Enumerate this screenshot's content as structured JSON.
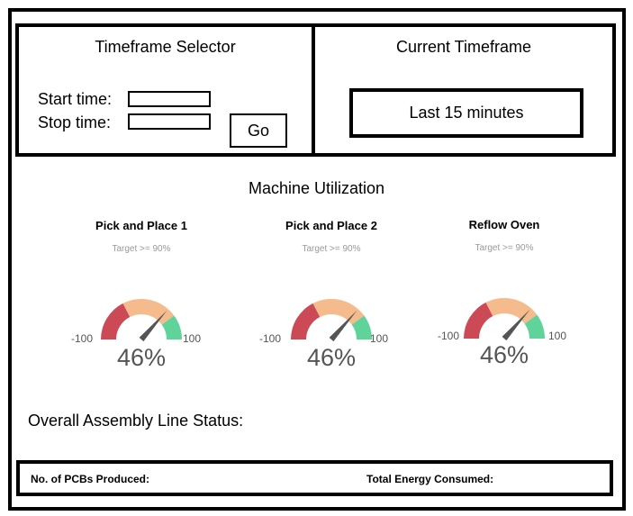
{
  "timeframe_selector": {
    "title": "Timeframe Selector",
    "start_label": "Start time:",
    "start_value": "",
    "stop_label": "Stop time:",
    "stop_value": "",
    "go_label": "Go"
  },
  "current_timeframe": {
    "title": "Current Timeframe",
    "value": "Last 15 minutes"
  },
  "machine_utilization": {
    "title": "Machine Utilization",
    "gauges": [
      {
        "name": "Pick and Place 1",
        "target": "Target >= 90%",
        "min": "-100",
        "max": "100",
        "value_label": "46%",
        "value": 46
      },
      {
        "name": "Pick and Place 2",
        "target": "Target >= 90%",
        "min": "-100",
        "max": "100",
        "value_label": "46%",
        "value": 46
      },
      {
        "name": "Reflow Oven",
        "target": "Target >= 90%",
        "min": "-100",
        "max": "100",
        "value_label": "46%",
        "value": 46
      }
    ],
    "colors": {
      "low": "#cc4a56",
      "mid": "#f5bb8c",
      "high": "#5fd39a",
      "needle": "#555555"
    }
  },
  "overall_status": {
    "label": "Overall Assembly Line Status:"
  },
  "footer": {
    "pcbs_label": "No. of PCBs Produced:",
    "energy_label": "Total Energy Consumed:"
  }
}
